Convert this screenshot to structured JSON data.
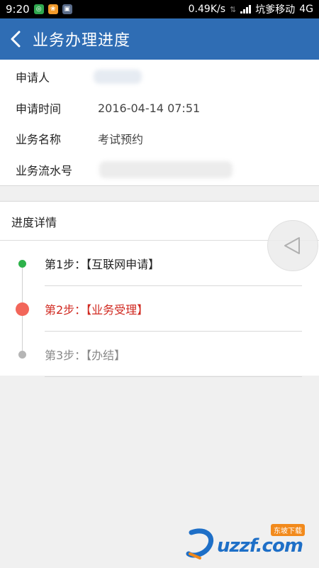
{
  "status_bar": {
    "time": "9:20",
    "speed": "0.49K/s",
    "carrier": "坑爹移动",
    "network": "4G"
  },
  "header": {
    "title": "业务办理进度"
  },
  "info": {
    "applicant_label": "申请人",
    "applicant_value": "",
    "apply_time_label": "申请时间",
    "apply_time_value": "2016-04-14 07:51",
    "business_name_label": "业务名称",
    "business_name_value": "考试预约",
    "serial_label": "业务流水号",
    "serial_value": ""
  },
  "progress": {
    "title": "进度详情",
    "steps": [
      {
        "text": "第1步：【互联网申请】",
        "color": "#222222",
        "dot_color": "#2db24a",
        "state": "done"
      },
      {
        "text": "第2步：【业务受理】",
        "color": "#d0281f",
        "dot_color": "#f2665a",
        "state": "current"
      },
      {
        "text": "第3步：【办结】",
        "color": "#888888",
        "dot_color": "#b5b5b5",
        "state": "pending"
      }
    ]
  },
  "watermark": {
    "brand": "uzzf.com",
    "tag": "东坡下载"
  },
  "colors": {
    "header_bg": "#2f6db4",
    "page_bg": "#f0f0f0"
  }
}
